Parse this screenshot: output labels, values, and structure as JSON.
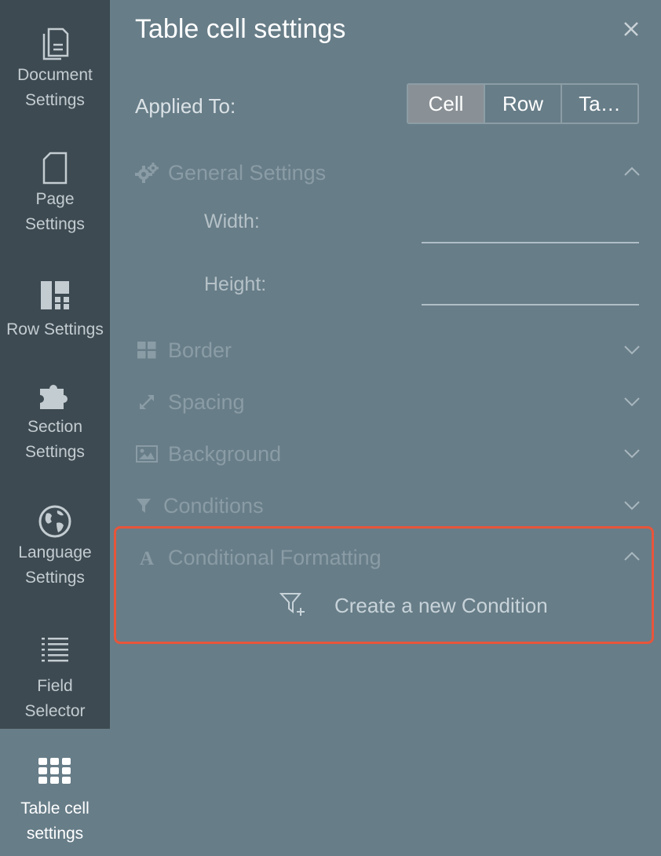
{
  "sidebar": {
    "items": [
      {
        "label": "Document\nSettings",
        "icon": "document-icon"
      },
      {
        "label": "Page\nSettings",
        "icon": "page-icon"
      },
      {
        "label": "Row Settings",
        "icon": "row-layout-icon"
      },
      {
        "label": "Section\nSettings",
        "icon": "puzzle-icon"
      },
      {
        "label": "Language\nSettings",
        "icon": "globe-icon"
      },
      {
        "label": "Field\nSelector",
        "icon": "list-icon"
      },
      {
        "label": "Table cell\nsettings",
        "icon": "grid-icon",
        "active": true
      }
    ]
  },
  "panel": {
    "title": "Table cell settings",
    "close_icon": "close-icon",
    "applied_to": {
      "label": "Applied To:",
      "options": [
        "Cell",
        "Row",
        "Ta…"
      ],
      "selected": "Cell"
    },
    "sections": {
      "general": {
        "label": "General Settings",
        "icon": "gears-icon",
        "expanded": true
      },
      "border": {
        "label": "Border",
        "icon": "border-grid-icon",
        "expanded": false
      },
      "spacing": {
        "label": "Spacing",
        "icon": "resize-arrows-icon",
        "expanded": false
      },
      "background": {
        "label": "Background",
        "icon": "image-icon",
        "expanded": false
      },
      "conditions": {
        "label": "Conditions",
        "icon": "filter-icon",
        "expanded": false
      },
      "conditional_formatting": {
        "label": "Conditional Formatting",
        "icon": "font-a-icon",
        "expanded": true
      }
    },
    "fields": {
      "width": {
        "label": "Width:",
        "value": ""
      },
      "height": {
        "label": "Height:",
        "value": ""
      }
    },
    "create_condition": {
      "label": "Create a new Condition",
      "icon": "filter-add-icon"
    }
  },
  "colors": {
    "sidebar_bg": "#3d4a51",
    "panel_bg": "#677d88",
    "highlight_border": "#e8553a",
    "selected_segment": "#8a9196"
  }
}
